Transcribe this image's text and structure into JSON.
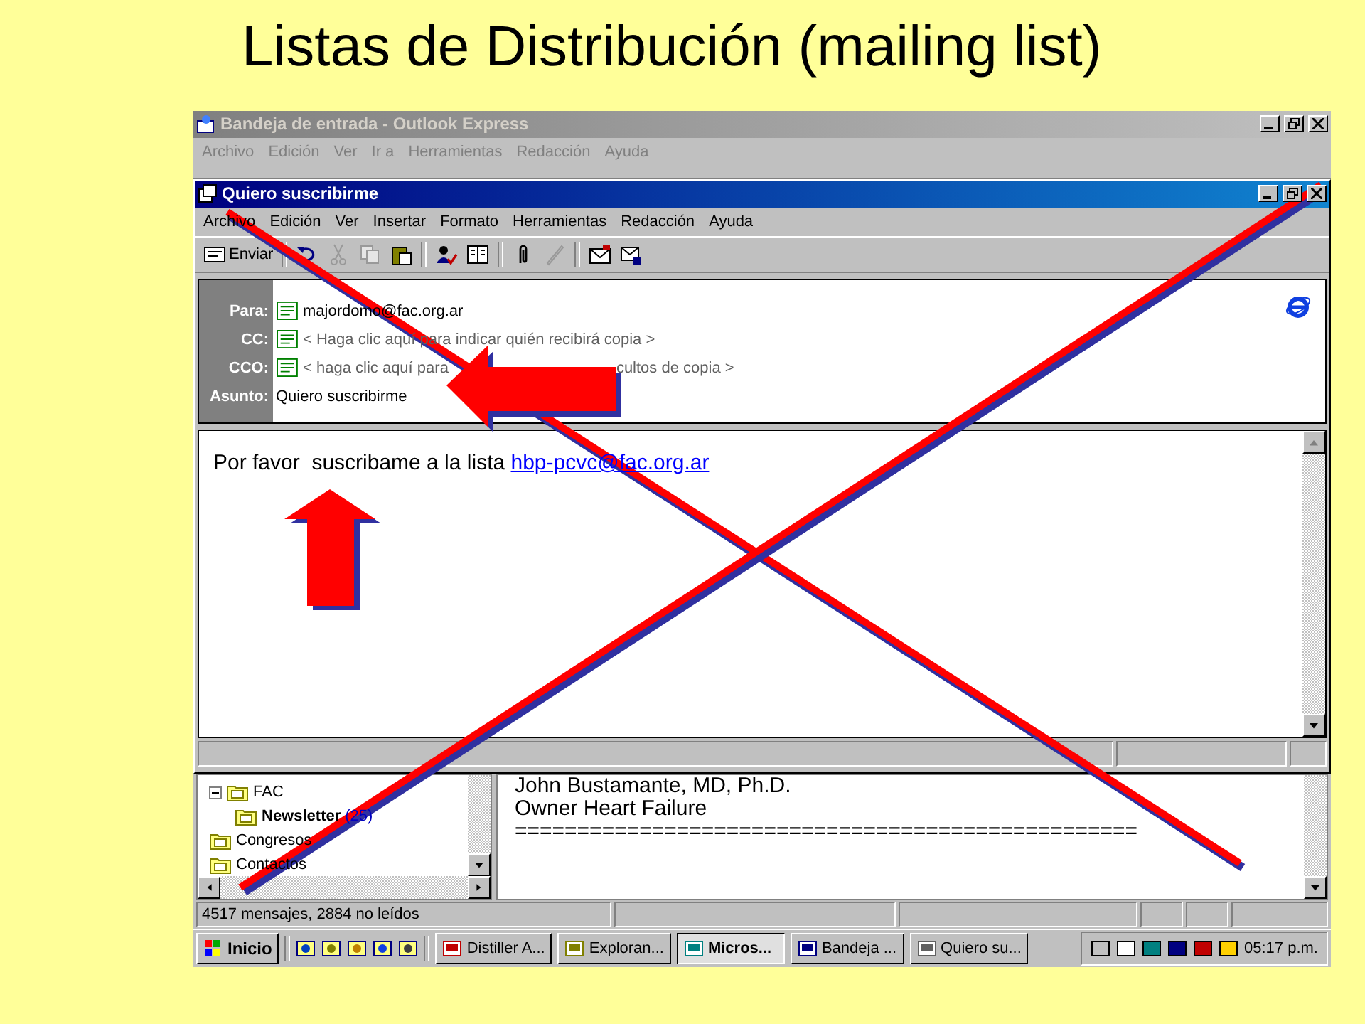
{
  "slide": {
    "title": "Listas de Distribución (mailing list)"
  },
  "main_window": {
    "title": "Bandeja de entrada - Outlook Express",
    "menu": [
      "Archivo",
      "Edición",
      "Ver",
      "Ir a",
      "Herramientas",
      "Redacción",
      "Ayuda"
    ]
  },
  "compose_window": {
    "title": "Quiero suscribirme",
    "menu": [
      "Archivo",
      "Edición",
      "Ver",
      "Insertar",
      "Formato",
      "Herramientas",
      "Redacción",
      "Ayuda"
    ],
    "toolbar": [
      {
        "kind": "send",
        "label": "Enviar",
        "disabled": false
      },
      {
        "kind": "separator"
      },
      {
        "kind": "undo",
        "disabled": false
      },
      {
        "kind": "cut",
        "disabled": true
      },
      {
        "kind": "copy",
        "disabled": true
      },
      {
        "kind": "paste",
        "disabled": false
      },
      {
        "kind": "separator"
      },
      {
        "kind": "check",
        "disabled": false
      },
      {
        "kind": "book",
        "disabled": false
      },
      {
        "kind": "separator"
      },
      {
        "kind": "attach",
        "disabled": false
      },
      {
        "kind": "pen",
        "disabled": true
      },
      {
        "kind": "separator"
      },
      {
        "kind": "sign",
        "disabled": false
      },
      {
        "kind": "lock",
        "disabled": false
      }
    ],
    "header_fields": [
      {
        "label": "Para:",
        "value": "majordomo@fac.org.ar"
      },
      {
        "label": "CC:",
        "placeholder": "< Haga clic aquí para indicar quién recibirá copia >"
      },
      {
        "label": "CCO:",
        "hint_start": "< haga clic aquí para",
        "hint_end": "cultos de copia >"
      },
      {
        "label": "Asunto:",
        "value": "Quiero suscribirme"
      }
    ],
    "body": {
      "text": "Por favor  suscribame a la lista ",
      "link": "hbp-pcvc@fac.org.ar"
    }
  },
  "folder_tree": [
    {
      "label": "FAC",
      "expanded": true,
      "children": [
        {
          "label": "Newsletter",
          "count": "(25)"
        }
      ]
    },
    {
      "label": "Congresos"
    },
    {
      "label": "Contactos"
    }
  ],
  "preview": {
    "lines": [
      "John Bustamante, MD, Ph.D.",
      "Owner Heart Failure",
      "=================================================="
    ]
  },
  "status_bar": {
    "text": "4517 mensajes, 2884 no leídos"
  },
  "taskbar": {
    "start": "Inicio",
    "tasks": [
      {
        "label": "Distiller A...",
        "selected": false
      },
      {
        "label": "Exploran...",
        "selected": false
      },
      {
        "label": "Micros...",
        "selected": true
      },
      {
        "label": "Bandeja ...",
        "selected": false
      },
      {
        "label": "Quiero su...",
        "selected": false
      }
    ],
    "clock": "05:17 p.m."
  }
}
